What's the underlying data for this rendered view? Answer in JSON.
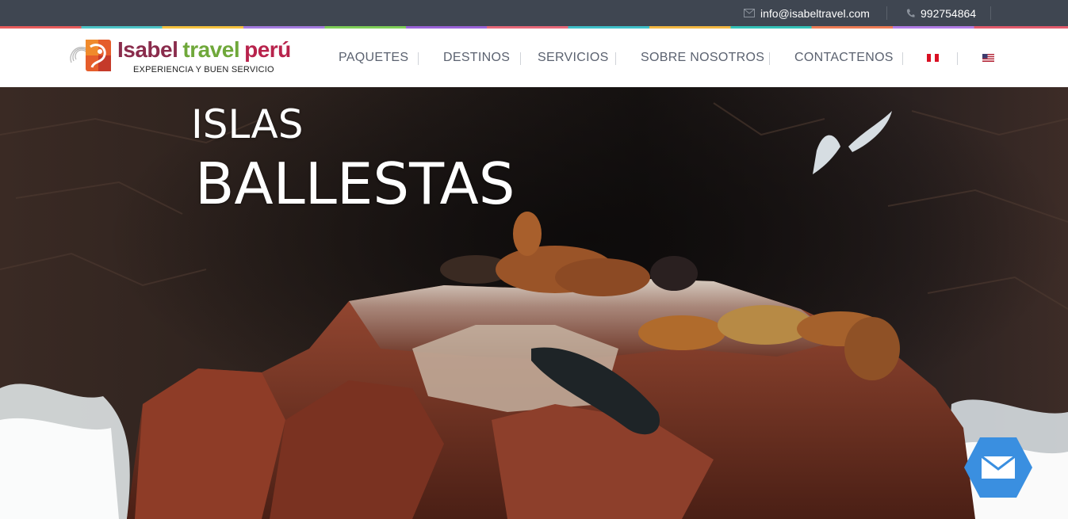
{
  "topbar": {
    "email": "info@isabeltravel.com",
    "phone": "992754864",
    "email_icon": "envelope-icon",
    "phone_icon": "phone-icon"
  },
  "header": {
    "logo": {
      "brand_word_1": "Isabel",
      "brand_word_2": "travel",
      "brand_word_3": "perú",
      "tagline": "EXPERIENCIA Y BUEN SERVICIO"
    },
    "nav": [
      {
        "label": "PAQUETES"
      },
      {
        "label": "DESTINOS"
      },
      {
        "label": "SERVICIOS"
      },
      {
        "label": "SOBRE NOSOTROS"
      },
      {
        "label": "CONTACTENOS"
      }
    ],
    "languages": [
      {
        "name": "peru-flag-icon"
      },
      {
        "name": "usa-flag-icon"
      }
    ]
  },
  "hero": {
    "title_line_1": "ISLAS",
    "title_line_2": "BALLESTAS"
  },
  "floating": {
    "mail_icon": "mail-icon"
  },
  "colors": {
    "topbar_bg": "#3f4651",
    "nav_text": "#5b6270",
    "brand_purple": "#8a2c4c",
    "brand_green": "#6fa83a",
    "brand_red": "#b8234c",
    "mail_button": "#3a8fe0"
  }
}
